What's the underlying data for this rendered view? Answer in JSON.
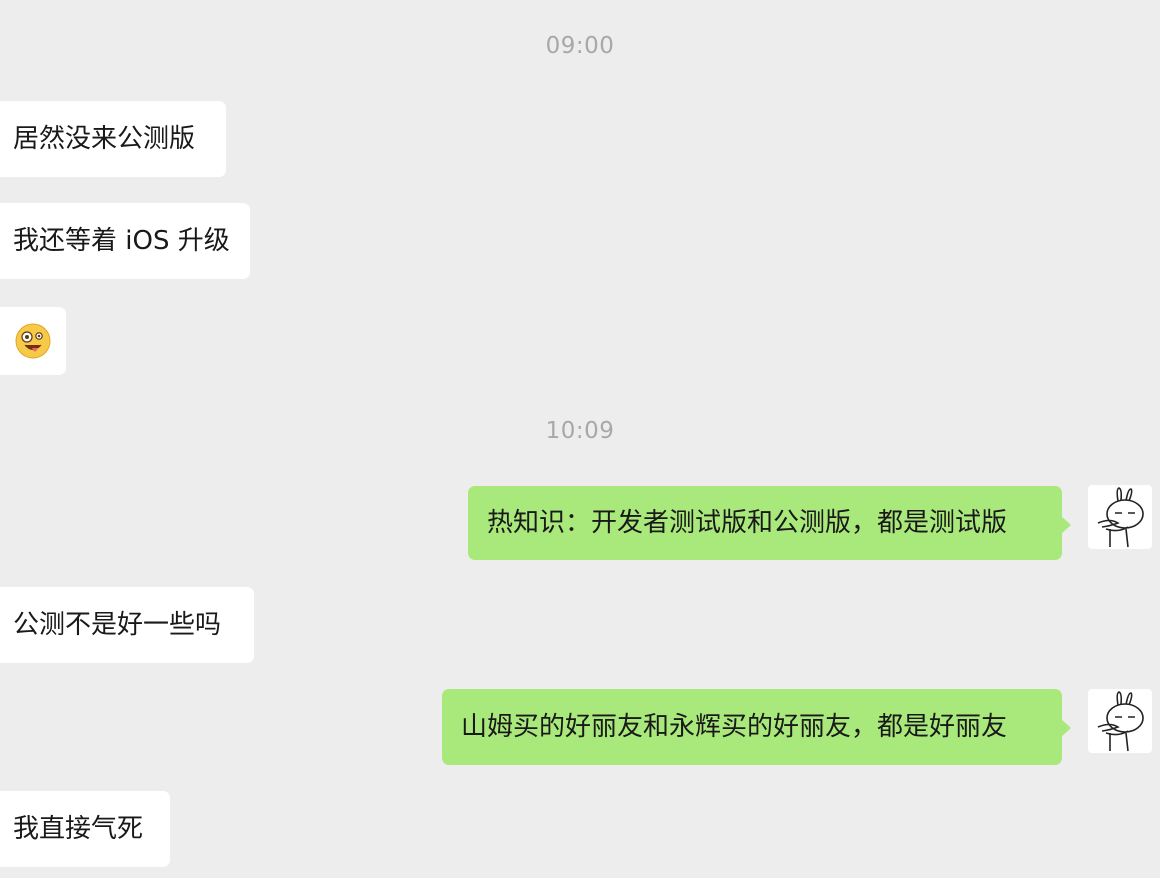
{
  "messages": [
    {
      "type": "timestamp",
      "text": "09:00"
    },
    {
      "type": "incoming",
      "text": "居然没来公测版"
    },
    {
      "type": "incoming",
      "text": "我还等着 iOS 升级"
    },
    {
      "type": "incoming_emoji",
      "emoji": "zany-face-icon"
    },
    {
      "type": "timestamp",
      "text": "10:09"
    },
    {
      "type": "outgoing",
      "text": "热知识：开发者测试版和公测版，都是测试版"
    },
    {
      "type": "incoming",
      "text": "公测不是好一些吗"
    },
    {
      "type": "outgoing",
      "text": "山姆买的好丽友和永辉买的好丽友，都是好丽友"
    },
    {
      "type": "incoming",
      "text": "我直接气死"
    }
  ],
  "colors": {
    "background": "#ededed",
    "incoming_bubble": "#ffffff",
    "outgoing_bubble": "#a9e87a",
    "timestamp_text": "#a8a8a8",
    "message_text": "#191919"
  },
  "avatar_icon": "rabbit-avatar-icon"
}
